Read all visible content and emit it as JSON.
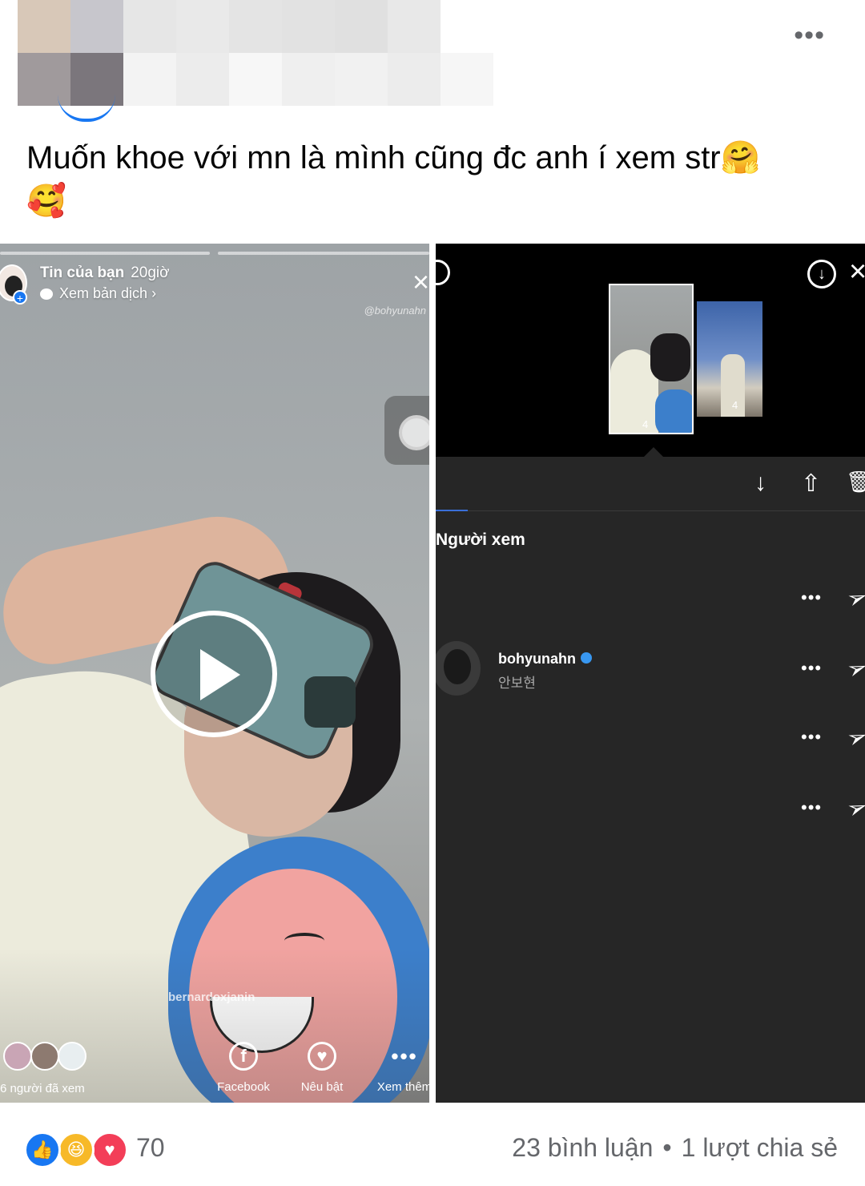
{
  "post": {
    "caption": "Muốn khoe với mn là mình cũng đc anh í xem str",
    "caption_emoji_1": "🤗",
    "caption_emoji_2": "🥰",
    "more_icon": "more-horizontal-icon",
    "more_label": "•••"
  },
  "story": {
    "title": "Tin của bạn",
    "time": "20giờ",
    "translate": "Xem bản dịch",
    "translate_chevron": "›",
    "close": "×",
    "watermark_top": "@bohyunahn",
    "watermark_bottom": "bernardoxjanin",
    "viewers_label": "6 người đã xem",
    "actions": [
      {
        "label": "Facebook",
        "icon": "f"
      },
      {
        "label": "Nêu bật",
        "icon": "♥"
      },
      {
        "label": "Xem thêm",
        "icon": "•••"
      }
    ]
  },
  "insights": {
    "close": "×",
    "download": "↓",
    "thumb1_views": "4",
    "thumb2_views": "4",
    "tools": [
      "↓",
      "⇧",
      "🗑"
    ],
    "viewers_heading": "Người xem",
    "viewer": {
      "name": "bohyunahn",
      "subtitle": "안보현"
    },
    "row_dots": "•••",
    "row_send": "➢"
  },
  "footer": {
    "reaction_count": "70",
    "reactions": [
      {
        "name": "like",
        "color": "#1877f2",
        "glyph": "👍"
      },
      {
        "name": "haha",
        "color": "#f7b928",
        "glyph": "😆"
      },
      {
        "name": "love",
        "color": "#f33e58",
        "glyph": "♥"
      }
    ],
    "comments": "23 bình luận",
    "shares": "1 lượt chia sẻ",
    "separator": "•"
  },
  "colors": {
    "accent": "#1877f2",
    "text_secondary": "#65676b",
    "instagram_dark": "#262626"
  }
}
